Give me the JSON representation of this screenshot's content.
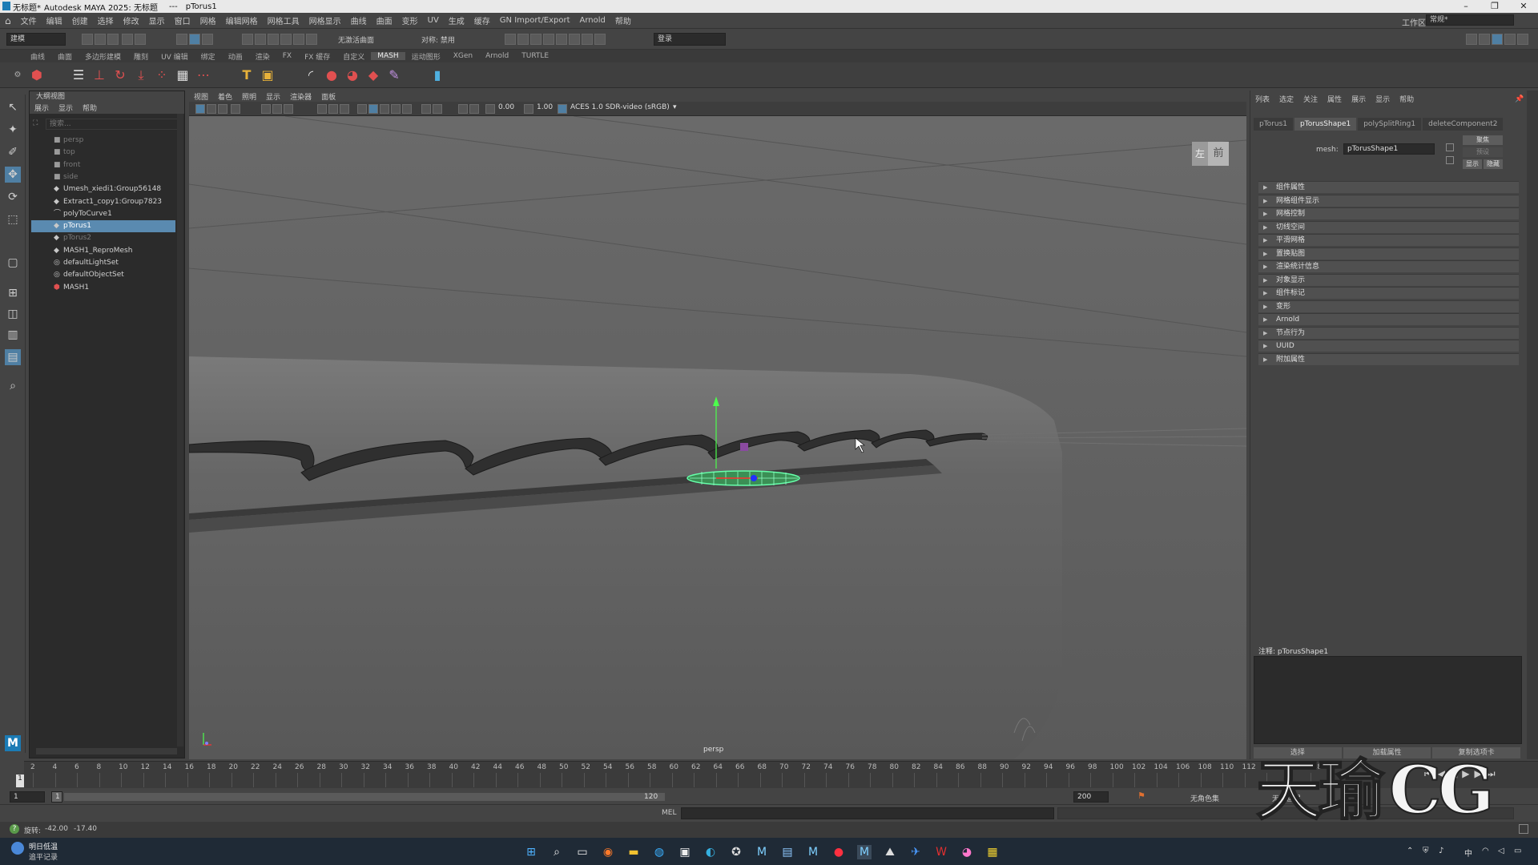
{
  "window": {
    "title_file": "无标题*",
    "title_app": "Autodesk MAYA 2025: 无标题",
    "title_sep": "---",
    "title_object": "pTorus1"
  },
  "menubar": {
    "items": [
      "文件",
      "编辑",
      "创建",
      "选择",
      "修改",
      "显示",
      "窗口",
      "网格",
      "编辑网格",
      "网格工具",
      "网格显示",
      "曲线",
      "曲面",
      "变形",
      "UV",
      "生成",
      "缓存",
      "GN Import/Export",
      "Arnold",
      "帮助"
    ],
    "workspace_label": "工作区:",
    "workspace_value": "常规*"
  },
  "statusline": {
    "mode": "建模",
    "live_surface": "无激活曲面",
    "symmetry": "对称: 禁用",
    "login": "登录"
  },
  "shelf": {
    "tabs": [
      "曲线",
      "曲面",
      "多边形建模",
      "雕刻",
      "UV 编辑",
      "绑定",
      "动画",
      "渲染",
      "FX",
      "FX 缓存",
      "自定义",
      "MASH",
      "运动图形",
      "XGen",
      "Arnold",
      "TURTLE"
    ],
    "active_tab": "MASH"
  },
  "outliner": {
    "title": "大纲视图",
    "menu": [
      "展示",
      "显示",
      "帮助"
    ],
    "search_placeholder": "搜索...",
    "items": [
      {
        "label": "persp",
        "icon": "camera-icon",
        "state": "dim"
      },
      {
        "label": "top",
        "icon": "camera-icon",
        "state": "dim"
      },
      {
        "label": "front",
        "icon": "camera-icon",
        "state": "dim"
      },
      {
        "label": "side",
        "icon": "camera-icon",
        "state": "dim"
      },
      {
        "label": "Umesh_xiedi1:Group56148",
        "icon": "mesh-icon",
        "state": "normal"
      },
      {
        "label": "Extract1_copy1:Group7823",
        "icon": "mesh-icon",
        "state": "normal"
      },
      {
        "label": "polyToCurve1",
        "icon": "curve-icon",
        "state": "normal"
      },
      {
        "label": "pTorus1",
        "icon": "mesh-icon",
        "state": "selected"
      },
      {
        "label": "pTorus2",
        "icon": "mesh-icon",
        "state": "dim"
      },
      {
        "label": "MASH1_ReproMesh",
        "icon": "mesh-icon",
        "state": "normal"
      },
      {
        "label": "defaultLightSet",
        "icon": "set-icon",
        "state": "normal"
      },
      {
        "label": "defaultObjectSet",
        "icon": "set-icon",
        "state": "normal"
      },
      {
        "label": "MASH1",
        "icon": "mash-icon",
        "state": "normal"
      }
    ]
  },
  "viewport": {
    "menu": [
      "视图",
      "着色",
      "照明",
      "显示",
      "渲染器",
      "面板"
    ],
    "field_a": "0.00",
    "field_b": "1.00",
    "colorspace": "ACES 1.0 SDR-video (sRGB)",
    "camera": "persp",
    "viewcube_left": "左",
    "viewcube_front": "前"
  },
  "attribute_editor": {
    "menu": [
      "列表",
      "选定",
      "关注",
      "属性",
      "展示",
      "显示",
      "帮助"
    ],
    "tabs": [
      "pTorus1",
      "pTorusShape1",
      "polySplitRing1",
      "deleteComponent2"
    ],
    "active_tab": "pTorusShape1",
    "mesh_label": "mesh:",
    "mesh_value": "pTorusShape1",
    "btn_focus": "聚焦",
    "btn_preset": "预设",
    "btn_show": "显示",
    "btn_hide": "隐藏",
    "sections": [
      "组件属性",
      "网格组件显示",
      "网格控制",
      "切线空间",
      "平滑网格",
      "置换贴图",
      "渲染统计信息",
      "对象显示",
      "组件标记",
      "变形",
      "Arnold",
      "节点行为",
      "UUID",
      "附加属性"
    ],
    "notes_label": "注释: pTorusShape1",
    "footer_buttons": [
      "选择",
      "加载属性",
      "复制选项卡"
    ]
  },
  "timeline": {
    "ticks": [
      "2",
      "4",
      "6",
      "8",
      "10",
      "12",
      "14",
      "16",
      "18",
      "20",
      "22",
      "24",
      "26",
      "28",
      "30",
      "32",
      "34",
      "36",
      "38",
      "40",
      "42",
      "44",
      "46",
      "48",
      "50",
      "52",
      "54",
      "56",
      "58",
      "60",
      "62",
      "64",
      "66",
      "68",
      "70",
      "72",
      "74",
      "76",
      "78",
      "80",
      "82",
      "84",
      "86",
      "88",
      "90",
      "92",
      "94",
      "96",
      "98",
      "100",
      "102",
      "104",
      "106",
      "108",
      "110",
      "112",
      "114",
      "116",
      "118"
    ],
    "current_frame": "1"
  },
  "range": {
    "start": "1",
    "inner_start": "1",
    "inner_end": "120",
    "end": "200",
    "character_set": "无角色集",
    "anim_layer": "无动画层"
  },
  "commandline": {
    "label": "MEL"
  },
  "helpline": {
    "rotate_label": "旋转:",
    "rotate_x": "-42.00",
    "rotate_y": "-17.40"
  },
  "taskbar": {
    "weather_title": "明日低温",
    "weather_sub": "追平记录",
    "ime": "中"
  },
  "watermark": {
    "text_a": "天瑜",
    "text_b": "CG"
  }
}
